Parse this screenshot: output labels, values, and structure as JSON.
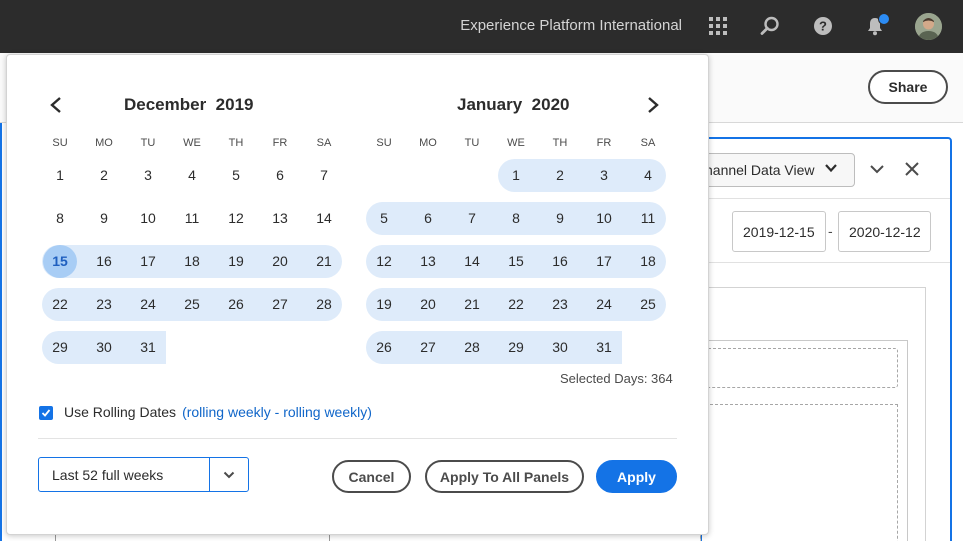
{
  "topbar": {
    "org_name": "Experience Platform International",
    "icons": [
      "apps-grid-icon",
      "search-icon",
      "help-icon",
      "bell-icon",
      "user-avatar"
    ],
    "notification_dot_color": "#2c8cf4"
  },
  "background": {
    "share_label": "Share",
    "data_view_label": "hannel Data View",
    "start_date": "2019-12-15",
    "end_date": "2020-12-12",
    "date_separator": "-"
  },
  "calendar": {
    "prev_month_icon": "chevron-left-icon",
    "next_month_icon": "chevron-right-icon",
    "weekday_labels": [
      "SU",
      "MO",
      "TU",
      "WE",
      "TH",
      "FR",
      "SA"
    ],
    "months": [
      {
        "name": "December",
        "year": "2019",
        "weeks": [
          [
            "1",
            "2",
            "3",
            "4",
            "5",
            "6",
            "7"
          ],
          [
            "8",
            "9",
            "10",
            "11",
            "12",
            "13",
            "14"
          ],
          [
            "15",
            "16",
            "17",
            "18",
            "19",
            "20",
            "21"
          ],
          [
            "22",
            "23",
            "24",
            "25",
            "26",
            "27",
            "28"
          ],
          [
            "29",
            "30",
            "31",
            "",
            "",
            "",
            ""
          ]
        ]
      },
      {
        "name": "January",
        "year": "2020",
        "weeks": [
          [
            "",
            "",
            "",
            "1",
            "2",
            "3",
            "4"
          ],
          [
            "5",
            "6",
            "7",
            "8",
            "9",
            "10",
            "11"
          ],
          [
            "12",
            "13",
            "14",
            "15",
            "16",
            "17",
            "18"
          ],
          [
            "19",
            "20",
            "21",
            "22",
            "23",
            "24",
            "25"
          ],
          [
            "26",
            "27",
            "28",
            "29",
            "30",
            "31",
            ""
          ]
        ]
      }
    ],
    "range_start_day": "15",
    "selected_days_text": "Selected Days: 364",
    "range_color": "#deebfa",
    "range_start_color": "#a8cdf5"
  },
  "rolling": {
    "checked": true,
    "label": "Use Rolling Dates",
    "link": "(rolling weekly - rolling weekly)"
  },
  "footer": {
    "preset_value": "Last 52 full weeks",
    "cancel_label": "Cancel",
    "apply_all_label": "Apply To All Panels",
    "apply_label": "Apply",
    "accent_color": "#1473e6"
  }
}
